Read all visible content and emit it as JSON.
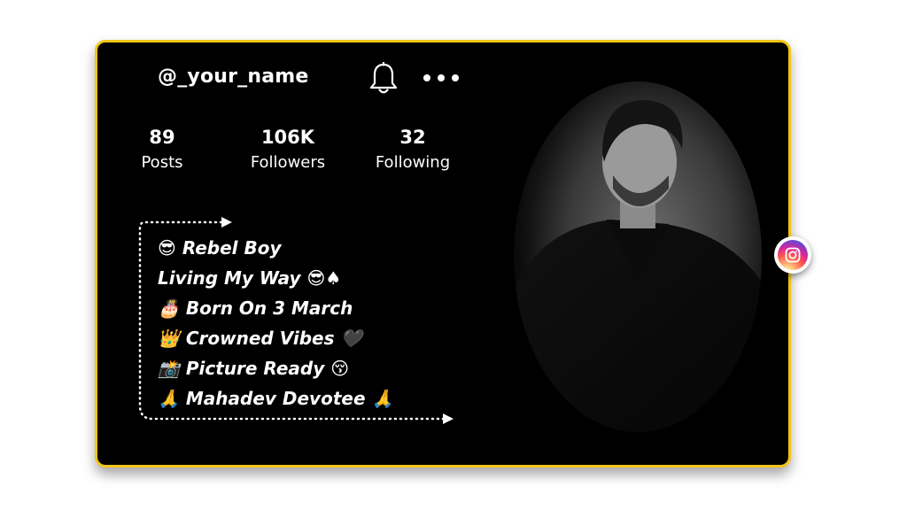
{
  "profile": {
    "username": "@_your_name",
    "stats": [
      {
        "value": "89",
        "label": "Posts"
      },
      {
        "value": "106K",
        "label": "Followers"
      },
      {
        "value": "32",
        "label": "Following"
      }
    ],
    "bio": [
      "😎 Rebel Boy",
      "Living My Way 😎♠",
      "🎂 Born On 3 March",
      "👑 Crowned Vibes 🖤",
      "📸 Picture Ready 😚",
      "🙏 Mahadev Devotee 🙏"
    ]
  },
  "icons": {
    "notification": "bell-icon",
    "more": "more-options-icon",
    "social": "instagram-icon"
  },
  "colors": {
    "card_background": "#000000",
    "card_border": "#f2c418",
    "text": "#ffffff"
  }
}
